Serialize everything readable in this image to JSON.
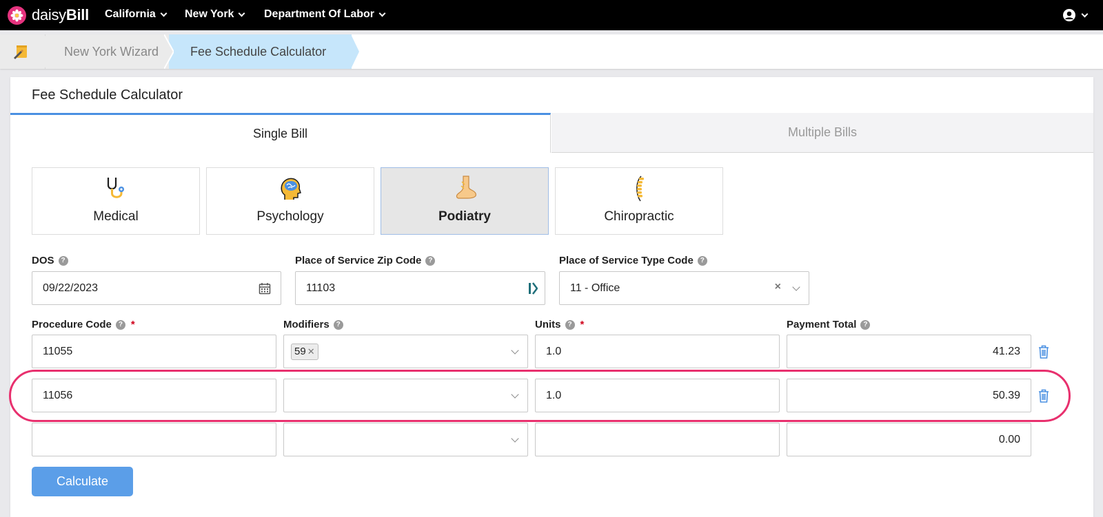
{
  "app": {
    "logo_prefix": "daisy",
    "logo_suffix": "Bill"
  },
  "topnav": {
    "items": [
      {
        "label": "California"
      },
      {
        "label": "New York"
      },
      {
        "label": "Department Of Labor"
      }
    ],
    "user_icon": "user-circle-icon"
  },
  "breadcrumb": {
    "home_icon": "pencil-note-icon",
    "items": [
      {
        "label": "New York Wizard"
      },
      {
        "label": "Fee Schedule Calculator"
      }
    ]
  },
  "page": {
    "title": "Fee Schedule Calculator"
  },
  "tabs": [
    {
      "label": "Single Bill",
      "active": true
    },
    {
      "label": "Multiple Bills",
      "active": false
    }
  ],
  "specialties": [
    {
      "label": "Medical",
      "icon": "stethoscope-icon"
    },
    {
      "label": "Psychology",
      "icon": "brain-head-icon"
    },
    {
      "label": "Podiatry",
      "icon": "foot-icon",
      "selected": true
    },
    {
      "label": "Chiropractic",
      "icon": "spine-icon"
    }
  ],
  "fields": {
    "dos": {
      "label": "DOS",
      "value": "09/22/2023"
    },
    "zip": {
      "label": "Place of Service Zip Code",
      "value": "11103"
    },
    "pos_type": {
      "label": "Place of Service Type Code",
      "value": "11 - Office"
    }
  },
  "columns": {
    "procedure": "Procedure Code",
    "modifiers": "Modifiers",
    "units": "Units",
    "payment": "Payment Total"
  },
  "rows": [
    {
      "procedure": "11055",
      "modifier_tag": "59",
      "units": "1.0",
      "payment": "41.23"
    },
    {
      "procedure": "11056",
      "modifier_tag": "",
      "units": "1.0",
      "payment": "50.39"
    },
    {
      "procedure": "",
      "modifier_tag": "",
      "units": "",
      "payment": "0.00"
    }
  ],
  "actions": {
    "calculate_label": "Calculate"
  },
  "colors": {
    "accent": "#4a90e2",
    "highlight": "#e8306e",
    "brand": "#e5337e",
    "active_crumb": "#c6e6fb"
  }
}
